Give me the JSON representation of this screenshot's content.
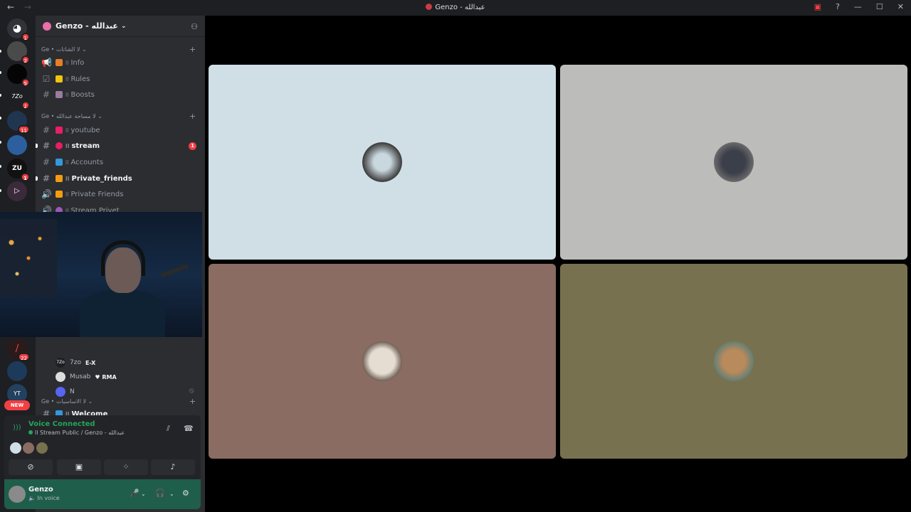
{
  "titlebar": {
    "title": "Genzo - عبدالله",
    "back_icon": "arrow-left-icon",
    "forward_icon": "arrow-right-icon",
    "minimize": "—",
    "maximize": "☐",
    "close": "✕"
  },
  "servers": [
    {
      "badge": "1"
    },
    {
      "badge": "2"
    },
    {
      "badge": "5"
    },
    {
      "badge": "1"
    },
    {
      "badge": "11"
    },
    {
      "badge": ""
    },
    {
      "badge": "1"
    },
    {
      "badge": ""
    },
    {
      "badge": ""
    },
    {
      "badge": "22"
    },
    {
      "badge": ""
    },
    {
      "badge": ""
    }
  ],
  "new_badge": "NEW",
  "guild": {
    "name": "Genzo - عبدالله"
  },
  "categories": [
    {
      "label": "Ge • لا الشاتات ⌄"
    },
    {
      "label": "Ge • لا مساحة عبدالله ⌄"
    },
    {
      "label": "Ge • لا الاساسيات ⌄"
    }
  ],
  "channels": [
    {
      "bars": "ll",
      "name": "Info"
    },
    {
      "bars": "ll",
      "name": "Rules"
    },
    {
      "bars": "ll",
      "name": "Boosts"
    },
    {
      "bars": "ll",
      "name": "youtube"
    },
    {
      "bars": "ll",
      "name": "stream",
      "badge": "1"
    },
    {
      "bars": "ll",
      "name": "Accounts"
    },
    {
      "bars": "ll",
      "name": "Private_friends"
    },
    {
      "bars": "ll",
      "name": "Private Friends"
    },
    {
      "bars": "ll",
      "name": "Stream Privet"
    },
    {
      "bars": "ll",
      "name": "Welcome"
    }
  ],
  "voice_users": [
    {
      "name": "7zo",
      "tag": "E-X"
    },
    {
      "name": "Musab",
      "tag": "♥ RMA"
    },
    {
      "name": "N",
      "tag": ""
    }
  ],
  "voice_panel": {
    "title": "Voice Connected",
    "subtitle": "ll Stream Public / Genzo - عبدالله"
  },
  "user": {
    "name": "Genzo",
    "status": "In voice"
  },
  "colors": {
    "tile1": "#d0dfe6",
    "tile2": "#bcbcbb",
    "tile3": "#8b6c62",
    "tile4": "#787150",
    "accent_green": "#23a55a",
    "badge_red": "#f23f43"
  }
}
